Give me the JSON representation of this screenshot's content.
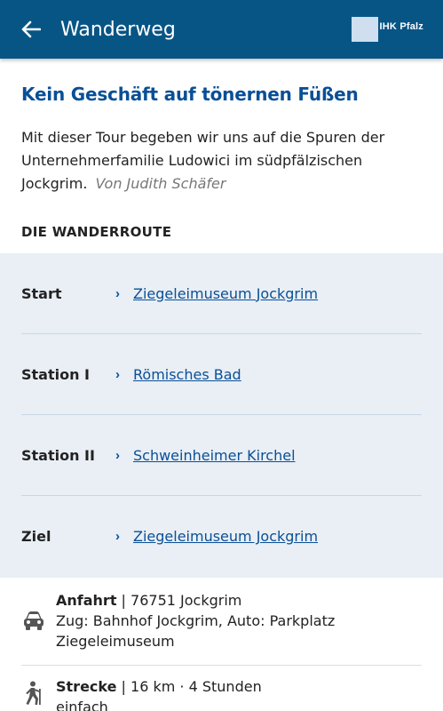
{
  "appbar": {
    "title": "Wanderweg",
    "logo_text": "IHK Pfalz"
  },
  "article": {
    "headline": "Kein Geschäft auf tönernen Füßen",
    "intro": "Mit dieser Tour begeben wir uns auf die Spuren der Unternehmerfamilie Ludowici im südpfälzischen Jockgrim.",
    "author": "Von Judith Schäfer"
  },
  "route": {
    "title": "DIE WANDERROUTE",
    "stops": [
      {
        "label": "Start",
        "link": "Ziegeleimuseum Jockgrim"
      },
      {
        "label": "Station I",
        "link": "Römisches Bad"
      },
      {
        "label": "Station II",
        "link": "Schweinheimer Kirchel"
      },
      {
        "label": "Ziel",
        "link": "Ziegeleimuseum Jockgrim"
      }
    ]
  },
  "info": {
    "anfahrt": {
      "label": "Anfahrt",
      "value": "76751 Jockgrim",
      "detail": "Zug: Bahnhof Jockgrim, Auto: Parkplatz Ziegeleimuseum",
      "icon": "car-icon"
    },
    "strecke": {
      "label": "Strecke",
      "value": "16 km · 4 Stunden",
      "detail": "einfach",
      "icon": "hiker-icon"
    }
  },
  "colors": {
    "appbar": "#075585",
    "accent": "#0a4f96",
    "route_bg": "#e9eff5"
  }
}
